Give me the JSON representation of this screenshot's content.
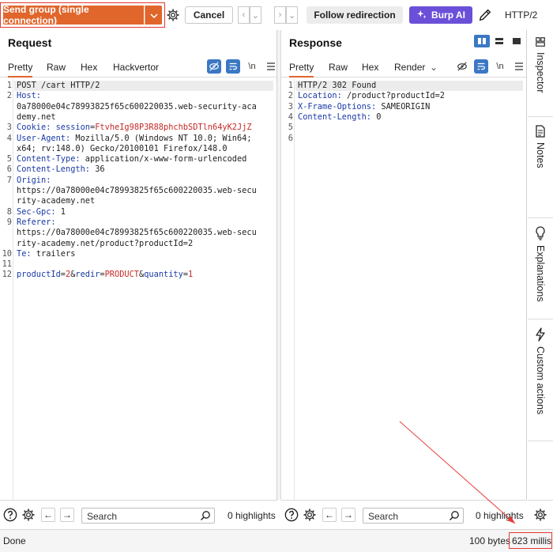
{
  "toolbar": {
    "send_label": "Send group (single connection)",
    "cancel_label": "Cancel",
    "follow_label": "Follow redirection",
    "burp_ai_label": "Burp AI",
    "protocol": "HTTP/2"
  },
  "request": {
    "title": "Request",
    "tabs": [
      "Pretty",
      "Raw",
      "Hex",
      "Hackvertor"
    ],
    "newline_label": "\\n",
    "lines": [
      {
        "n": "1",
        "parts": [
          {
            "t": "POST /cart HTTP/2",
            "c": ""
          }
        ]
      },
      {
        "n": "2",
        "parts": [
          {
            "t": "Host:",
            "c": "k"
          }
        ]
      },
      {
        "n": "",
        "parts": [
          {
            "t": "0a78000e04c78993825f65c600220035.web-security-aca",
            "c": ""
          }
        ]
      },
      {
        "n": "",
        "parts": [
          {
            "t": "demy.net",
            "c": ""
          }
        ]
      },
      {
        "n": "3",
        "parts": [
          {
            "t": "Cookie: ",
            "c": "k"
          },
          {
            "t": "session",
            "c": "k"
          },
          {
            "t": "=",
            "c": ""
          },
          {
            "t": "FtvheIg98P3R88phchbSDTln64yK2JjZ",
            "c": "v"
          }
        ]
      },
      {
        "n": "4",
        "parts": [
          {
            "t": "User-Agent: ",
            "c": "k"
          },
          {
            "t": "Mozilla/5.0 (Windows NT 10.0; Win64;",
            "c": ""
          }
        ]
      },
      {
        "n": "",
        "parts": [
          {
            "t": "x64; rv:148.0) Gecko/20100101 Firefox/148.0",
            "c": ""
          }
        ]
      },
      {
        "n": "5",
        "parts": [
          {
            "t": "Content-Type: ",
            "c": "k"
          },
          {
            "t": "application/x-www-form-urlencoded",
            "c": ""
          }
        ]
      },
      {
        "n": "6",
        "parts": [
          {
            "t": "Content-Length: ",
            "c": "k"
          },
          {
            "t": "36",
            "c": ""
          }
        ]
      },
      {
        "n": "7",
        "parts": [
          {
            "t": "Origin:",
            "c": "k"
          }
        ]
      },
      {
        "n": "",
        "parts": [
          {
            "t": "https://0a78000e04c78993825f65c600220035.web-secu",
            "c": ""
          }
        ]
      },
      {
        "n": "",
        "parts": [
          {
            "t": "rity-academy.net",
            "c": ""
          }
        ]
      },
      {
        "n": "8",
        "parts": [
          {
            "t": "Sec-Gpc: ",
            "c": "k"
          },
          {
            "t": "1",
            "c": ""
          }
        ]
      },
      {
        "n": "9",
        "parts": [
          {
            "t": "Referer:",
            "c": "k"
          }
        ]
      },
      {
        "n": "",
        "parts": [
          {
            "t": "https://0a78000e04c78993825f65c600220035.web-secu",
            "c": ""
          }
        ]
      },
      {
        "n": "",
        "parts": [
          {
            "t": "rity-academy.net/product?productId=2",
            "c": ""
          }
        ]
      },
      {
        "n": "10",
        "parts": [
          {
            "t": "Te: ",
            "c": "k"
          },
          {
            "t": "trailers",
            "c": ""
          }
        ]
      },
      {
        "n": "11",
        "parts": [
          {
            "t": "",
            "c": ""
          }
        ]
      },
      {
        "n": "12",
        "parts": [
          {
            "t": "productId",
            "c": "k"
          },
          {
            "t": "=",
            "c": ""
          },
          {
            "t": "2",
            "c": "v"
          },
          {
            "t": "&",
            "c": ""
          },
          {
            "t": "redir",
            "c": "k"
          },
          {
            "t": "=",
            "c": ""
          },
          {
            "t": "PRODUCT",
            "c": "v"
          },
          {
            "t": "&",
            "c": ""
          },
          {
            "t": "quantity",
            "c": "k"
          },
          {
            "t": "=",
            "c": ""
          },
          {
            "t": "1",
            "c": "v"
          }
        ]
      }
    ],
    "search_placeholder": "Search",
    "highlights": "0 highlights"
  },
  "response": {
    "title": "Response",
    "tabs": [
      "Pretty",
      "Raw",
      "Hex",
      "Render"
    ],
    "newline_label": "\\n",
    "lines": [
      {
        "n": "1",
        "parts": [
          {
            "t": "HTTP/2 302 Found",
            "c": ""
          }
        ]
      },
      {
        "n": "2",
        "parts": [
          {
            "t": "Location: ",
            "c": "k"
          },
          {
            "t": "/product?productId=2",
            "c": ""
          }
        ]
      },
      {
        "n": "3",
        "parts": [
          {
            "t": "X-Frame-Options: ",
            "c": "k"
          },
          {
            "t": "SAMEORIGIN",
            "c": ""
          }
        ]
      },
      {
        "n": "4",
        "parts": [
          {
            "t": "Content-Length: ",
            "c": "k"
          },
          {
            "t": "0",
            "c": ""
          }
        ]
      },
      {
        "n": "5",
        "parts": [
          {
            "t": "",
            "c": ""
          }
        ]
      },
      {
        "n": "6",
        "parts": [
          {
            "t": "",
            "c": ""
          }
        ]
      }
    ],
    "search_placeholder": "Search",
    "highlights": "0 highlights"
  },
  "sidebar": {
    "items": [
      "Inspector",
      "Notes",
      "Explanations",
      "Custom actions"
    ]
  },
  "status": {
    "left": "Done",
    "bytes": "100 bytes",
    "millis": "623 millis"
  },
  "colors": {
    "accent": "#e0662c",
    "burp_ai": "#6b4fd8",
    "selected": "#3b78c4",
    "annotation": "#e53935",
    "key": "#1a3aa5",
    "value": "#c62828"
  }
}
